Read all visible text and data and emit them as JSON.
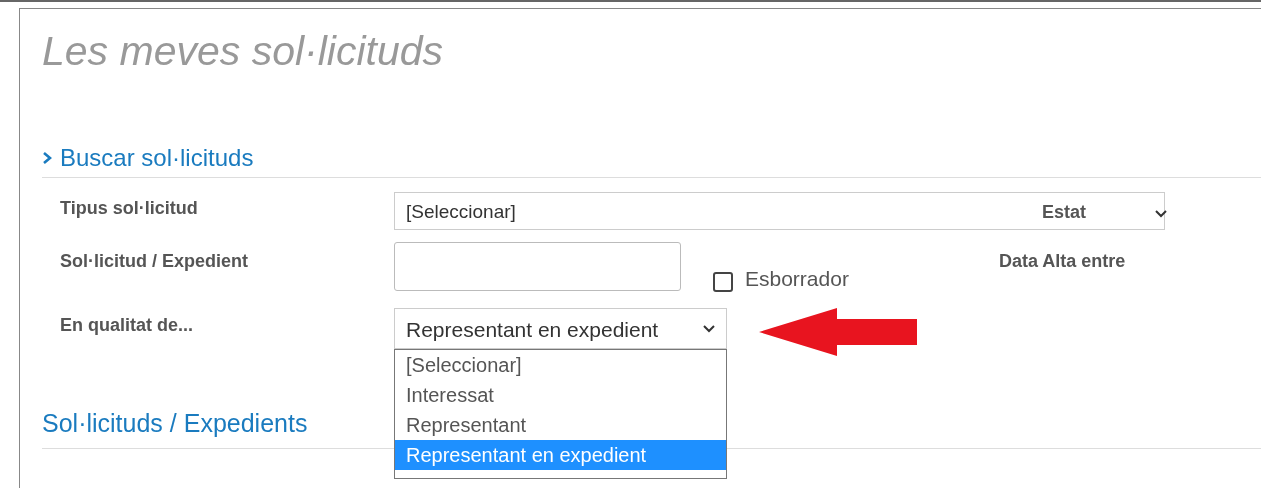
{
  "title": "Les meves sol·licituds",
  "search": {
    "heading": "Buscar sol·licituds",
    "type_filter": {
      "label": "Tipus sol·licitud",
      "value": "[Seleccionar]"
    },
    "status_filter": {
      "label": "Estat"
    },
    "request_field": {
      "label": "Sol·licitud / Expedient"
    },
    "draft_checkbox": {
      "label": "Esborrador",
      "checked": false
    },
    "date_label": "Data Alta entre",
    "role_filter": {
      "label": "En qualitat de...",
      "value": "Representant en expedient",
      "open": true,
      "options": [
        {
          "label": "[Seleccionar]",
          "selected": false
        },
        {
          "label": "Interessat",
          "selected": false
        },
        {
          "label": "Representant",
          "selected": false
        },
        {
          "label": "Representant en expedient",
          "selected": true
        }
      ]
    }
  },
  "results": {
    "heading": "Sol·licituds / Expedients"
  }
}
